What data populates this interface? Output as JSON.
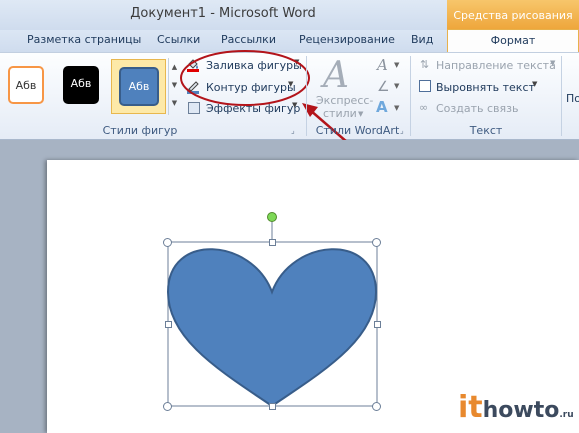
{
  "window": {
    "title": "Документ1  -  Microsoft Word",
    "context_header": "Средства рисования"
  },
  "tabs": {
    "page_layout": "Разметка страницы",
    "references": "Ссылки",
    "mailings": "Рассылки",
    "review": "Рецензирование",
    "view": "Вид",
    "format": "Формат"
  },
  "shape_styles": {
    "sample_label": "Абв",
    "fill": "Заливка фигуры",
    "outline": "Контур фигуры",
    "effects": "Эффекты фигур",
    "group_label": "Стили фигур"
  },
  "wordart": {
    "express_line1": "Экспресс-",
    "express_line2": "стили",
    "group_label": "Стили WordArt"
  },
  "text_group": {
    "direction": "Направление текста",
    "align": "Выровнять текст",
    "link": "Создать связь",
    "group_label": "Текст"
  },
  "overflow_label": "По",
  "watermark": {
    "letter": "it",
    "word": "howto",
    "suffix": ".ru"
  },
  "colors": {
    "heart_fill": "#4f81bd",
    "heart_stroke": "#385d8a",
    "highlight_ring": "#c00000",
    "context_tab": "#f2b046"
  }
}
